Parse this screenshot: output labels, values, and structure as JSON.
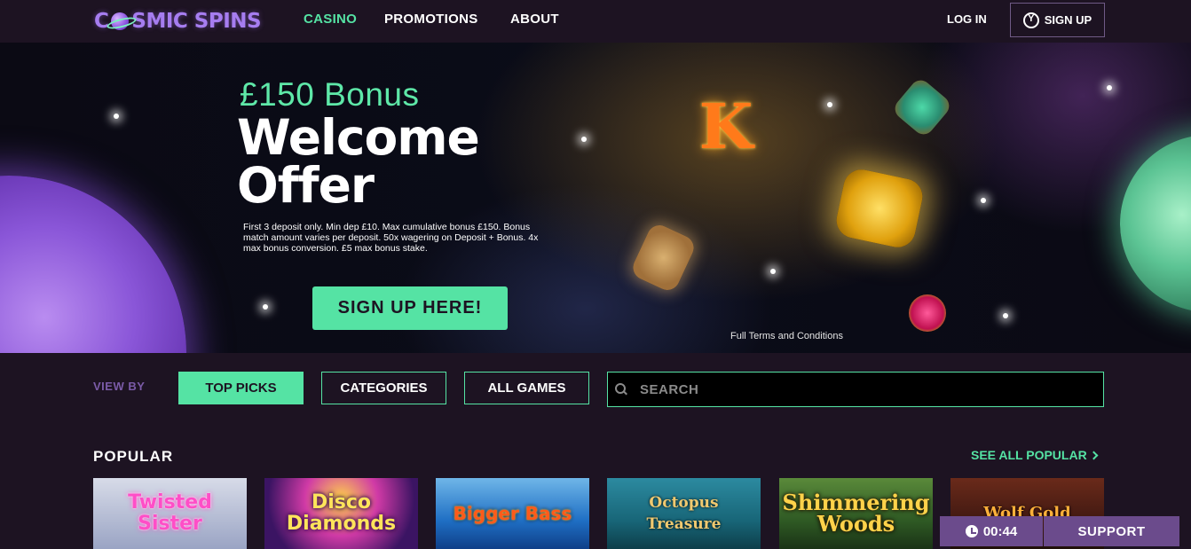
{
  "header": {
    "logo_text": "COSMIC SPINS",
    "nav": {
      "casino": "CASINO",
      "promotions": "PROMOTIONS",
      "about": "ABOUT"
    },
    "login": "LOG IN",
    "signup": "SIGN UP"
  },
  "hero": {
    "subtitle": "£150 Bonus",
    "title": "Welcome Offer",
    "terms": "First 3 deposit only. Min dep £10. Max cumulative bonus £150. Bonus match amount varies per deposit. 50x wagering on Deposit + Bonus. 4x max bonus conversion. £5 max bonus stake.",
    "cta": "SIGN UP HERE!",
    "tc_link": "Full Terms and Conditions",
    "symbols": [
      "letter-k-icon",
      "gold-compass-icon",
      "golden-key-icon",
      "green-idol-icon",
      "ruby-gem-icon"
    ]
  },
  "filters": {
    "view_by": "VIEW BY",
    "top_picks": "TOP PICKS",
    "categories": "CATEGORIES",
    "all_games": "ALL GAMES",
    "search_placeholder": "SEARCH"
  },
  "popular": {
    "title": "POPULAR",
    "see_all": "SEE ALL POPULAR",
    "games": [
      "Twisted Sister",
      "Disco Diamonds",
      "Bigger Bass",
      "Octopus Treasure",
      "Shimmering Woods",
      "Wolf Gold"
    ]
  },
  "widgets": {
    "timer": "00:44",
    "support": "SUPPORT"
  },
  "colors": {
    "accent": "#55e3a4",
    "background": "#1d1322",
    "widget": "#6b4b8c"
  }
}
